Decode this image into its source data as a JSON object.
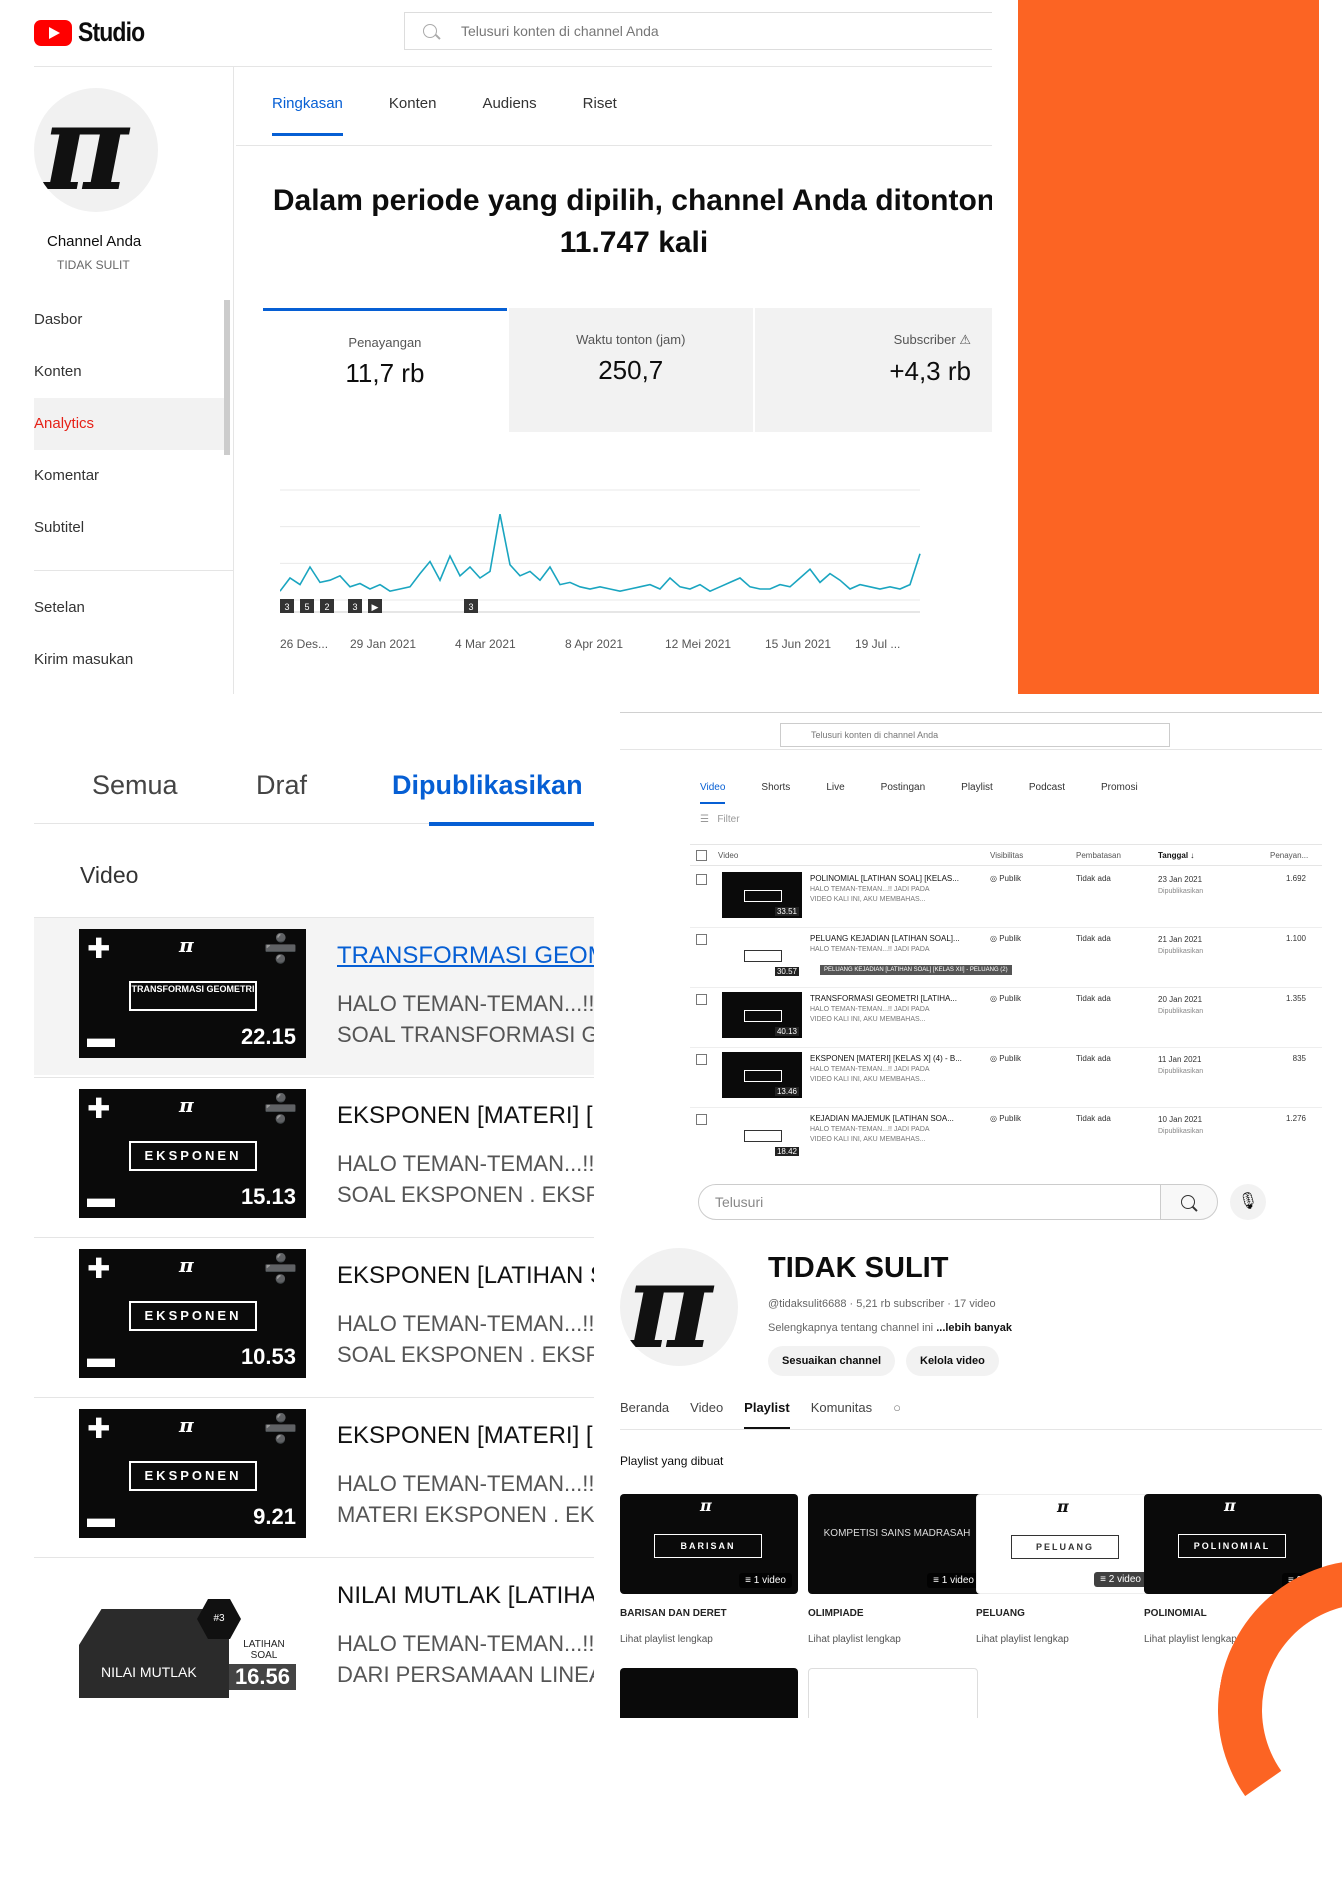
{
  "colors": {
    "accent": "#065fd4",
    "brand_red": "#ff0000",
    "orange": "#fc6423",
    "active_nav": "#e62117"
  },
  "studio": {
    "logo_text": "Studio",
    "search_placeholder": "Telusuri konten di channel Anda",
    "channel_label": "Channel Anda",
    "channel_handle": "TIDAK SULIT",
    "nav": [
      "Dasbor",
      "Konten",
      "Analytics",
      "Komentar",
      "Subtitel",
      "Setelan",
      "Kirim masukan"
    ],
    "tabs": [
      "Ringkasan",
      "Konten",
      "Audiens",
      "Riset"
    ],
    "headline_1": "Dalam periode yang dipilih, channel Anda ditonton",
    "headline_2": "11.747 kali",
    "metrics": [
      {
        "label": "Penayangan",
        "value": "11,7 rb"
      },
      {
        "label": "Waktu tonton (jam)",
        "value": "250,7"
      },
      {
        "label": "Subscriber",
        "value": "+4,3 rb"
      }
    ],
    "markers": [
      "3",
      "5",
      "2",
      "3",
      "▶",
      "3"
    ],
    "x_labels": [
      "26 Des...",
      "29 Jan 2021",
      "4 Mar 2021",
      "8 Apr 2021",
      "12 Mei 2021",
      "15 Jun 2021",
      "19 Jul ..."
    ]
  },
  "chart_data": {
    "type": "line",
    "title": "",
    "xlabel": "",
    "ylabel": "",
    "x": [
      "26 Des...",
      "29 Jan 2021",
      "4 Mar 2021",
      "8 Apr 2021",
      "12 Mei 2021",
      "15 Jun 2021",
      "19 Jul ..."
    ],
    "series": [
      {
        "values": [
          8,
          20,
          14,
          30,
          16,
          18,
          22,
          12,
          15,
          10,
          14,
          8,
          10,
          12,
          24,
          35,
          18,
          40,
          22,
          30,
          20,
          26,
          78,
          32,
          22,
          26,
          18,
          30,
          14,
          16,
          12,
          10,
          12,
          10,
          8,
          10,
          12,
          14,
          10,
          20,
          12,
          10,
          14,
          8,
          12,
          16,
          20,
          12,
          10,
          10,
          14,
          12,
          20,
          28,
          16,
          24,
          18,
          10,
          14,
          12,
          10,
          12,
          10,
          14,
          42
        ]
      }
    ],
    "ylim": [
      0,
      100
    ],
    "grid": true
  },
  "content": {
    "tabs": [
      "Semua",
      "Draf",
      "Dipublikasikan"
    ],
    "section_label": "Video",
    "videos": [
      {
        "title": "TRANSFORMASI GEOM",
        "desc1": "HALO TEMAN-TEMAN...!!",
        "desc2": "SOAL TRANSFORMASI G",
        "duration": "22.15",
        "thumb_label": "TRANSFORMASI GEOMETRI"
      },
      {
        "title": "EKSPONEN [MATERI] [K",
        "desc1": "HALO TEMAN-TEMAN...!!",
        "desc2": "SOAL EKSPONEN . EKSP",
        "duration": "15.13",
        "thumb_label": "EKSPONEN"
      },
      {
        "title": "EKSPONEN [LATIHAN S",
        "desc1": "HALO TEMAN-TEMAN...!!",
        "desc2": "SOAL EKSPONEN . EKSP",
        "duration": "10.53",
        "thumb_label": "EKSPONEN"
      },
      {
        "title": "EKSPONEN [MATERI] [K",
        "desc1": "HALO TEMAN-TEMAN...!!",
        "desc2": "MATERI EKSPONEN . EK",
        "duration": "9.21",
        "thumb_label": "EKSPONEN"
      },
      {
        "title": "NILAI MUTLAK [LATIHA",
        "desc1": "HALO TEMAN-TEMAN...!!",
        "desc2": "DARI PERSAMAAN LINEA",
        "duration": "16.56",
        "thumb_label": "NILAI MUTLAK",
        "thumb_badge": "#3",
        "thumb_side": "LATIHAN SOAL"
      }
    ]
  },
  "manager": {
    "search_placeholder": "Telusuri konten di channel Anda",
    "tabs": [
      "Video",
      "Shorts",
      "Live",
      "Postingan",
      "Playlist",
      "Podcast",
      "Promosi"
    ],
    "filter_label": "Filter",
    "columns": [
      "Video",
      "Visibilitas",
      "Pembatasan",
      "Tanggal ↓",
      "Penayan..."
    ],
    "rows": [
      {
        "title": "POLINOMIAL [LATIHAN SOAL] [KELAS...",
        "desc1": "HALO TEMAN-TEMAN...!! JADI PADA",
        "desc2": "VIDEO KALI INI, AKU MEMBAHAS...",
        "visibility": "Publik",
        "restriction": "Tidak ada",
        "date": "23 Jan 2021",
        "status": "Dipublikasikan",
        "views": "1.692",
        "duration": "33.51"
      },
      {
        "title": "PELUANG KEJADIAN [LATIHAN SOAL]...",
        "desc1": "HALO TEMAN-TEMAN...!! JADI PADA",
        "desc2": "",
        "visibility": "Publik",
        "restriction": "Tidak ada",
        "date": "21 Jan 2021",
        "status": "Dipublikasikan",
        "views": "1.100",
        "duration": "30.57"
      },
      {
        "title": "TRANSFORMASI GEOMETRI [LATIHA...",
        "desc1": "HALO TEMAN-TEMAN...!! JADI PADA",
        "desc2": "VIDEO KALI INI, AKU MEMBAHAS...",
        "visibility": "Publik",
        "restriction": "Tidak ada",
        "date": "20 Jan 2021",
        "status": "Dipublikasikan",
        "views": "1.355",
        "duration": "40.13"
      },
      {
        "title": "EKSPONEN [MATERI] [KELAS X] (4) - B...",
        "desc1": "HALO TEMAN-TEMAN...!! JADI PADA",
        "desc2": "VIDEO KALI INI, AKU MEMBAHAS...",
        "visibility": "Publik",
        "restriction": "Tidak ada",
        "date": "11 Jan 2021",
        "status": "Dipublikasikan",
        "views": "835",
        "duration": "13.46"
      },
      {
        "title": "KEJADIAN MAJEMUK [LATIHAN SOA...",
        "desc1": "HALO TEMAN-TEMAN...!! JADI PADA",
        "desc2": "VIDEO KALI INI, AKU MEMBAHAS...",
        "visibility": "Publik",
        "restriction": "Tidak ada",
        "date": "10 Jan 2021",
        "status": "Dipublikasikan",
        "views": "1.276",
        "duration": "18.42"
      }
    ],
    "tooltip": "PELUANG KEJADIAN [LATIHAN SOAL] [KELAS XII] - PELUANG (2)"
  },
  "channel": {
    "search_placeholder": "Telusuri",
    "name": "TIDAK SULIT",
    "meta": "@tidaksulit6688 · 5,21 rb subscriber · 17 video",
    "about": "Selengkapnya tentang channel ini",
    "about_more": "...lebih banyak",
    "btn_customize": "Sesuaikan channel",
    "btn_manage": "Kelola video",
    "tabs": [
      "Beranda",
      "Video",
      "Playlist",
      "Komunitas"
    ],
    "playlists_label": "Playlist yang dibuat",
    "playlists": [
      {
        "name": "BARISAN DAN DERET",
        "count": "1 video",
        "thumb": "BARISAN",
        "link": "Lihat playlist lengkap"
      },
      {
        "name": "OLIMPIADE",
        "count": "1 video",
        "thumb": "KOMPETISI SAINS MADRASAH",
        "link": "Lihat playlist lengkap"
      },
      {
        "name": "PELUANG",
        "count": "2 video",
        "thumb": "PELUANG",
        "link": "Lihat playlist lengkap"
      },
      {
        "name": "POLINOMIAL",
        "count": "3 v",
        "thumb": "POLINOMIAL",
        "link": "Lihat playlist lengkap"
      }
    ]
  }
}
